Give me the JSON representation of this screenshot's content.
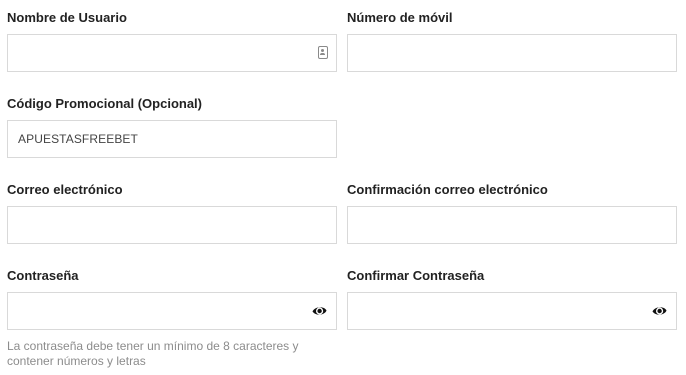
{
  "form": {
    "username": {
      "label": "Nombre de Usuario",
      "value": "",
      "icon": "contact-card-icon"
    },
    "mobile": {
      "label": "Número de móvil",
      "value": ""
    },
    "promo": {
      "label": "Código Promocional (Opcional)",
      "value": "APUESTASFREEBET"
    },
    "email": {
      "label": "Correo electrónico",
      "value": ""
    },
    "email_confirm": {
      "label": "Confirmación correo electrónico",
      "value": ""
    },
    "password": {
      "label": "Contraseña",
      "value": "",
      "icon": "eye-icon"
    },
    "password_confirm": {
      "label": "Confirmar Contraseña",
      "value": "",
      "icon": "eye-icon"
    },
    "password_hint": "La contraseña debe tener un mínimo de 8 caracteres y contener números y letras"
  },
  "colors": {
    "label_text": "#222222",
    "input_border": "#d9d9d9",
    "hint_text": "#8c8c8c",
    "icon": "#111111"
  }
}
